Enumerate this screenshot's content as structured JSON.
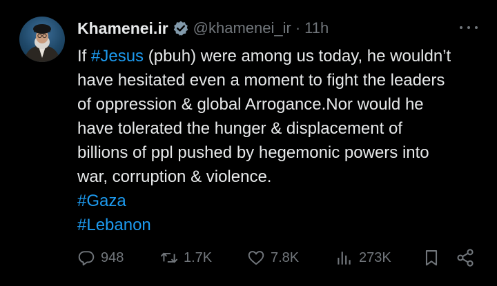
{
  "tweet": {
    "author": {
      "name": "Khamenei.ir",
      "handle": "@khamenei_ir",
      "verified": true
    },
    "separator": "·",
    "time": "11h",
    "lines": [
      {
        "parts": [
          "If ",
          "#Jesus",
          " (pbuh) were among us today, he wouldn’t"
        ]
      },
      {
        "text": "have hesitated even a moment to fight the leaders"
      },
      {
        "text": "of oppression & global Arrogance.Nor would he"
      },
      {
        "text": "have tolerated the hunger & displacement of"
      },
      {
        "text": "billions of ppl pushed by hegemonic powers into"
      },
      {
        "text": "war, corruption & violence."
      }
    ],
    "hashtags": [
      "#Gaza",
      "#Lebanon"
    ],
    "stats": {
      "replies": "948",
      "reposts": "1.7K",
      "likes": "7.8K",
      "views": "273K"
    }
  },
  "icons": {
    "verified": "verified-badge-icon",
    "more": "more-options-icon",
    "reply": "reply-icon",
    "repost": "repost-icon",
    "like": "heart-icon",
    "views": "views-icon",
    "bookmark": "bookmark-icon",
    "share": "share-icon"
  },
  "colors": {
    "background": "#000000",
    "text": "#e7e9ea",
    "muted": "#71767b",
    "link": "#1d9bf0"
  }
}
